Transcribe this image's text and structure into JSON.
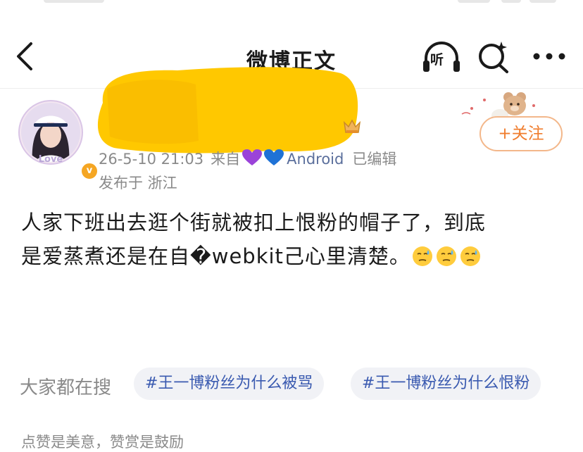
{
  "nav": {
    "title": "微博正文",
    "listen_label": "听"
  },
  "user": {
    "verified_mark": "v",
    "date": "26-5-10 21:03",
    "source_prefix": "来自",
    "source_device": "Android",
    "edited": "已编辑",
    "location": "发布于 浙江",
    "follow_label": "+关注"
  },
  "post": {
    "lines": [
      [
        "人家下班出去逛个街就被扣上恨粉的帽子了，到底"
      ],
      [
        "是爱蒸煮还是在自�webkit己心里清楚。"
      ]
    ]
  },
  "trending": {
    "label": "大家都在搜",
    "chips": [
      "#王一博粉丝为什么被骂",
      "#王一博粉丝为什么恨粉"
    ]
  },
  "footer": {
    "text": "点赞是美意，赞赏是鼓励"
  },
  "colors": {
    "accent_orange": "#f07d2e",
    "link_blue": "#3a5ab0",
    "redaction_yellow": "#ffc800"
  },
  "icons": [
    "back-arrow-icon",
    "listen-headphones-icon",
    "search-sparkle-icon",
    "more-dots-icon",
    "heart-purple-icon",
    "heart-blue-icon",
    "sweat-smile-emoji"
  ]
}
